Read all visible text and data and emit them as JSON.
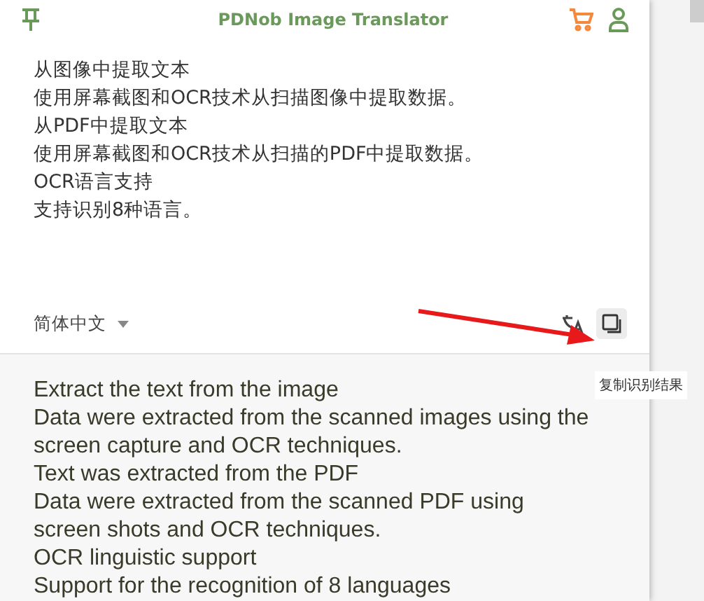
{
  "window": {
    "title": "PDNob Image Translator"
  },
  "source": {
    "lines": [
      "从图像中提取文本",
      "使用屏幕截图和OCR技术从扫描图像中提取数据。",
      "从PDF中提取文本",
      "使用屏幕截图和OCR技术从扫描的PDF中提取数据。",
      "OCR语言支持",
      "支持识别8种语言。"
    ],
    "language": "简体中文"
  },
  "tooltip": "复制识别结果",
  "result": {
    "lines": [
      "Extract the text from the image",
      "Data were extracted from the scanned images using the screen capture and OCR techniques.",
      "Text was extracted from the PDF",
      "Data were extracted from the scanned PDF using screen shots and OCR techniques.",
      "OCR linguistic support",
      "Support for the recognition of 8 languages"
    ]
  }
}
